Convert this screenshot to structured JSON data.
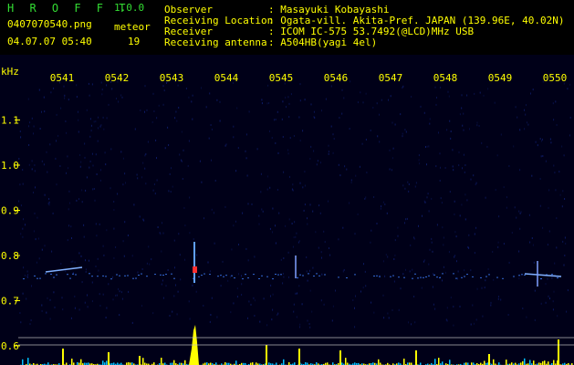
{
  "header": {
    "app_name": "H R O F F T",
    "version": "1.0.0",
    "filename": "0407070540.png",
    "datetime": "04.07.07 05:40",
    "meteor_label": "meteor",
    "meteor_count": "19",
    "info_labels": [
      "Observer",
      "Receiving Location",
      "Receiver",
      "Receiving antenna"
    ],
    "info_values": [
      ": Masayuki Kobayashi",
      ": Ogata-vill. Akita-Pref. JAPAN (139.96E, 40.02N)",
      ": ICOM IC-575 53.7492(@LCD)MHz USB",
      ": A504HB(yagi 4el)"
    ]
  },
  "spectrogram": {
    "y_unit": "kHz",
    "time_labels": [
      "0541",
      "0542",
      "0543",
      "0544",
      "0545",
      "0546",
      "0547",
      "0548",
      "0549",
      "0550"
    ],
    "freq_ticks": [
      {
        "label": "1.1",
        "khz": 1.1
      },
      {
        "label": "1.0",
        "khz": 1.0
      },
      {
        "label": "0.9",
        "khz": 0.9
      },
      {
        "label": "0.8",
        "khz": 0.8
      },
      {
        "label": "0.7",
        "khz": 0.7
      },
      {
        "label": "0.6",
        "khz": 0.6
      }
    ],
    "colors": {
      "background": "#000018",
      "axis_text": "#ffff00",
      "time_text": "#ffff00",
      "signal_line": "#4080ff",
      "hot_spot": "#ff3030",
      "bars": "#ffff00",
      "noise": "#00c0ff"
    }
  }
}
